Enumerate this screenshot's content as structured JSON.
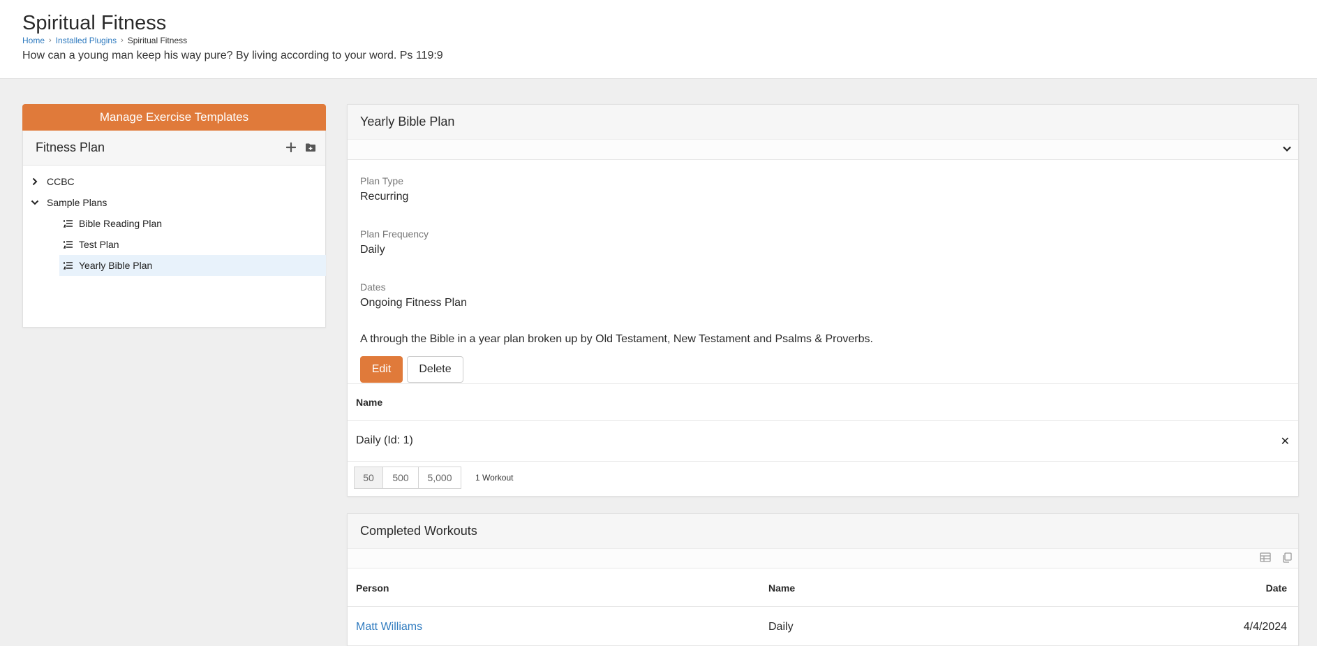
{
  "header": {
    "title": "Spiritual Fitness",
    "breadcrumb": [
      "Home",
      "Installed Plugins",
      "Spiritual Fitness"
    ],
    "verse": "How can a young man keep his way pure? By living according to your word. Ps 119:9"
  },
  "sidebar": {
    "manage_label": "Manage Exercise Templates",
    "tree_title": "Fitness Plan",
    "items": [
      {
        "label": "CCBC"
      },
      {
        "label": "Sample Plans"
      },
      {
        "label": "Bible Reading Plan"
      },
      {
        "label": "Test Plan"
      },
      {
        "label": "Yearly Bible Plan"
      }
    ]
  },
  "plan": {
    "title": "Yearly Bible Plan",
    "fields": [
      {
        "label": "Plan Type",
        "value": "Recurring"
      },
      {
        "label": "Plan Frequency",
        "value": "Daily"
      },
      {
        "label": "Dates",
        "value": "Ongoing Fitness Plan"
      }
    ],
    "description": "A through the Bible in a year plan broken up by Old Testament, New Testament and Psalms & Proverbs.",
    "edit_label": "Edit",
    "delete_label": "Delete",
    "grid_header": "Name",
    "grid_rows": [
      "Daily (Id: 1)"
    ],
    "delete_glyph": "✕",
    "pager": [
      "50",
      "500",
      "5,000"
    ],
    "count": "1 Workout"
  },
  "completed": {
    "title": "Completed Workouts",
    "columns": [
      "Person",
      "Name",
      "Date"
    ],
    "rows": [
      {
        "person": "Matt Williams",
        "name": "Daily",
        "date": "4/4/2024"
      }
    ]
  },
  "colors": {
    "accent": "#e07a3a",
    "link": "#2f7bbf",
    "selected": "#e8f2fb"
  }
}
